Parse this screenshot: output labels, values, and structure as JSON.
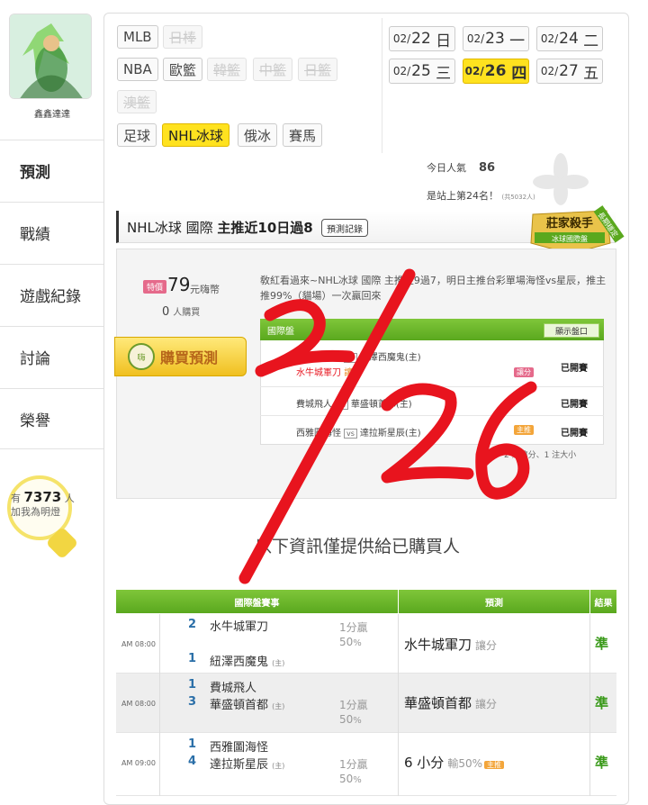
{
  "user": {
    "name": "鑫鑫達達"
  },
  "nav": {
    "items": [
      "預測",
      "戰績",
      "遊戲紀錄",
      "討論",
      "榮譽"
    ]
  },
  "bulb": {
    "prefix": "有",
    "count": "7373",
    "suffix": "人",
    "caption": "加我為明燈"
  },
  "sports": {
    "row1": [
      {
        "label": "MLB",
        "state": "normal"
      },
      {
        "label": "日棒",
        "state": "disabled"
      }
    ],
    "row2": [
      {
        "label": "NBA",
        "state": "normal"
      },
      {
        "label": "歐籃",
        "state": "normal"
      },
      {
        "label": "韓籃",
        "state": "disabled"
      },
      {
        "label": "中籃",
        "state": "disabled"
      },
      {
        "label": "日籃",
        "state": "disabled"
      }
    ],
    "row3": [
      {
        "label": "澳籃",
        "state": "disabled"
      }
    ],
    "row4": [
      {
        "label": "足球",
        "state": "normal"
      },
      {
        "label": "NHL冰球",
        "state": "selected"
      },
      {
        "label": "俄冰",
        "state": "normal"
      },
      {
        "label": "賽馬",
        "state": "normal"
      }
    ]
  },
  "dates": [
    {
      "month": "02/",
      "day": "22",
      "weekday": "日",
      "selected": false
    },
    {
      "month": "02/",
      "day": "23",
      "weekday": "一",
      "selected": false
    },
    {
      "month": "02/",
      "day": "24",
      "weekday": "二",
      "selected": false
    },
    {
      "month": "02/",
      "day": "25",
      "weekday": "三",
      "selected": false
    },
    {
      "month": "02/",
      "day": "26",
      "weekday": "四",
      "selected": true
    },
    {
      "month": "02/",
      "day": "27",
      "weekday": "五",
      "selected": false
    }
  ],
  "stats": {
    "popularity_label": "今日人氣",
    "popularity_value": "86",
    "rank_text": "是站上第24名！",
    "rank_sub": "(共5032人)"
  },
  "prediction": {
    "title_prefix": "NHL冰球 國際 ",
    "title_bold": "主推近10日過8",
    "record_button": "預測記錄",
    "badge_main": "莊家殺手",
    "badge_sub": "冰球國際盤",
    "badge_ribbon": "長期穩定",
    "price_tag": "特價",
    "price": "79",
    "price_unit": "元嗨幣",
    "buyers_count": "0",
    "buyers_label": "人購買",
    "buy_button": "購買預測",
    "buy_icon_text": "嗨",
    "description": "敎紅看過來~NHL冰球 國際 主推近9過7，明日主推台彩單場海怪vs星辰，推主推99%（貓場）一次贏回來",
    "inner_header": "國際盤",
    "show_odds_button": "顯示盤口",
    "games": [
      {
        "away": "水牛城軍刀",
        "home": "紐澤西魔鬼(主)",
        "pick": "水牛城軍刀",
        "pick_tag": "讓分",
        "tag": "讓分",
        "status": "已開賽"
      },
      {
        "away": "費城飛人",
        "home": "華盛頓首都(主)",
        "pick": "",
        "pick_tag": "",
        "tag": "",
        "status": "已開賽"
      },
      {
        "away": "西雅圖海怪",
        "home": "達拉斯星辰(主)",
        "pick": "",
        "pick_tag": "",
        "tag": "主推",
        "status": "已開賽"
      }
    ],
    "vs_label": "vs",
    "note": "2 注讓分、1 注大小"
  },
  "locked_message": "以下資訊僅提供給已購買人",
  "results": {
    "headers": [
      "國際盤賽事",
      "預測",
      "結果"
    ],
    "rows": [
      {
        "time": "AM 08:00",
        "away_num": "2",
        "away": "水牛城軍刀",
        "home_num": "1",
        "home": "紐澤西魔鬼",
        "home_tag": "(主)",
        "line": "1分贏",
        "pct": "50",
        "pct_unit": "%",
        "pick": "水牛城軍刀",
        "pick_type": "讓分",
        "pick_extra": "",
        "result": "準"
      },
      {
        "time": "AM 08:00",
        "away_num": "1",
        "away": "費城飛人",
        "home_num": "3",
        "home": "華盛頓首都",
        "home_tag": "(主)",
        "line": "1分贏",
        "pct": "50",
        "pct_unit": "%",
        "pick": "華盛頓首都",
        "pick_type": "讓分",
        "pick_extra": "",
        "result": "準"
      },
      {
        "time": "AM 09:00",
        "away_num": "1",
        "away": "西雅圖海怪",
        "home_num": "4",
        "home": "達拉斯星辰",
        "home_tag": "(主)",
        "line": "1分贏",
        "pct": "50",
        "pct_unit": "%",
        "pick": "6 小分",
        "pick_type": "輸50%",
        "pick_extra": "主推",
        "result": "準"
      }
    ]
  },
  "handwriting": {
    "text": "2/26",
    "color": "#e8141e"
  },
  "colors": {
    "accent_yellow": "#ffe21f",
    "green_header": "#5aa81e",
    "price_pink": "#e56a8b",
    "result_green": "#3a9a1a"
  }
}
